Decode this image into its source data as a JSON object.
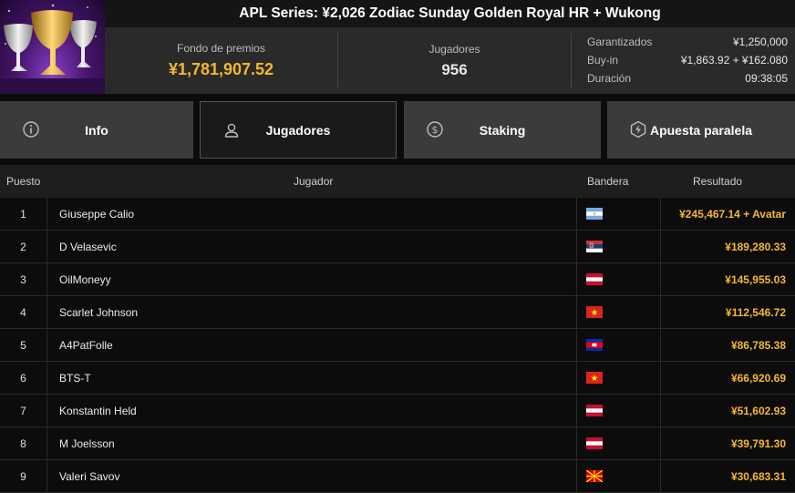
{
  "header": {
    "title": "APL Series: ¥2,026 Zodiac Sunday Golden Royal HR + Wukong",
    "image": "trophy-cups-image",
    "prize_pool_label": "Fondo de premios",
    "prize_pool_value": "¥1,781,907.52",
    "players_label": "Jugadores",
    "players_value": "956",
    "details": [
      {
        "label": "Garantizados",
        "value": "¥1,250,000"
      },
      {
        "label": "Buy-in",
        "value": "¥1,863.92 + ¥162.080"
      },
      {
        "label": "Duración",
        "value": "09:38:05"
      }
    ]
  },
  "tabs": [
    {
      "label": "Info",
      "icon": "info-icon",
      "active": false
    },
    {
      "label": "Jugadores",
      "icon": "user-icon",
      "active": true
    },
    {
      "label": "Staking",
      "icon": "staking-coin-icon",
      "active": false
    },
    {
      "label": "Apuesta paralela",
      "icon": "side-bet-icon",
      "active": false
    }
  ],
  "table": {
    "columns": {
      "position": "Puesto",
      "player": "Jugador",
      "flag": "Bandera",
      "result": "Resultado"
    },
    "rows": [
      {
        "position": "1",
        "player": "Giuseppe Calio",
        "flag": "argentina-flag",
        "result": "¥245,467.14 + Avatar"
      },
      {
        "position": "2",
        "player": "D Velasevic",
        "flag": "serbia-flag",
        "result": "¥189,280.33"
      },
      {
        "position": "3",
        "player": "OilMoneyy",
        "flag": "austria-flag",
        "result": "¥145,955.03"
      },
      {
        "position": "4",
        "player": "Scarlet Johnson",
        "flag": "vietnam-flag",
        "result": "¥112,546.72"
      },
      {
        "position": "5",
        "player": "A4PatFolle",
        "flag": "cambodia-flag",
        "result": "¥86,785.38"
      },
      {
        "position": "6",
        "player": "BTS-T",
        "flag": "vietnam-flag",
        "result": "¥66,920.69"
      },
      {
        "position": "7",
        "player": "Konstantin Held",
        "flag": "austria-flag",
        "result": "¥51,602.93"
      },
      {
        "position": "8",
        "player": "M Joelsson",
        "flag": "austria-flag",
        "result": "¥39,791.30"
      },
      {
        "position": "9",
        "player": "Valeri Savov",
        "flag": "north-macedonia-flag",
        "result": "¥30,683.31"
      }
    ]
  },
  "colors": {
    "accent": "#f5b731",
    "header_bg": "#2a2a2a",
    "tab_bg": "#3b3b3b",
    "active_tab_bg": "#1a1a1a"
  }
}
